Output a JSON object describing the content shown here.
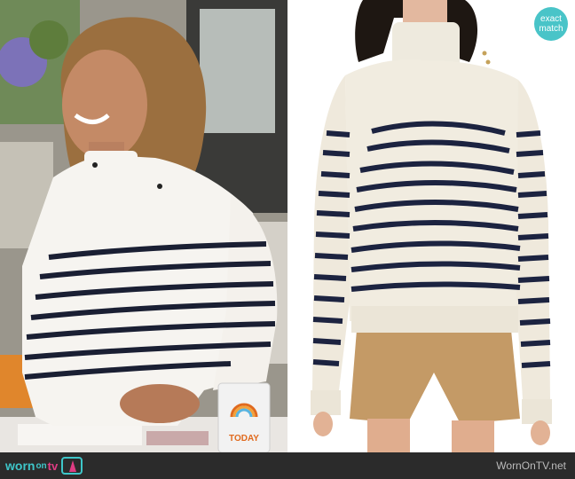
{
  "left_photo": {
    "cup_brand": "TODAY"
  },
  "right_photo": {
    "badge": {
      "line1": "exact",
      "line2": "match"
    }
  },
  "footer": {
    "logo": {
      "part1": "worn",
      "part2": "on",
      "part3": "tv"
    },
    "site": "WornOnTV.net"
  },
  "colors": {
    "teal": "#3ec6c9",
    "pink": "#e03c83",
    "footer_bg": "#2b2b2b",
    "stripe_navy": "#1c2340",
    "sweater_cream": "#f1ece0"
  }
}
